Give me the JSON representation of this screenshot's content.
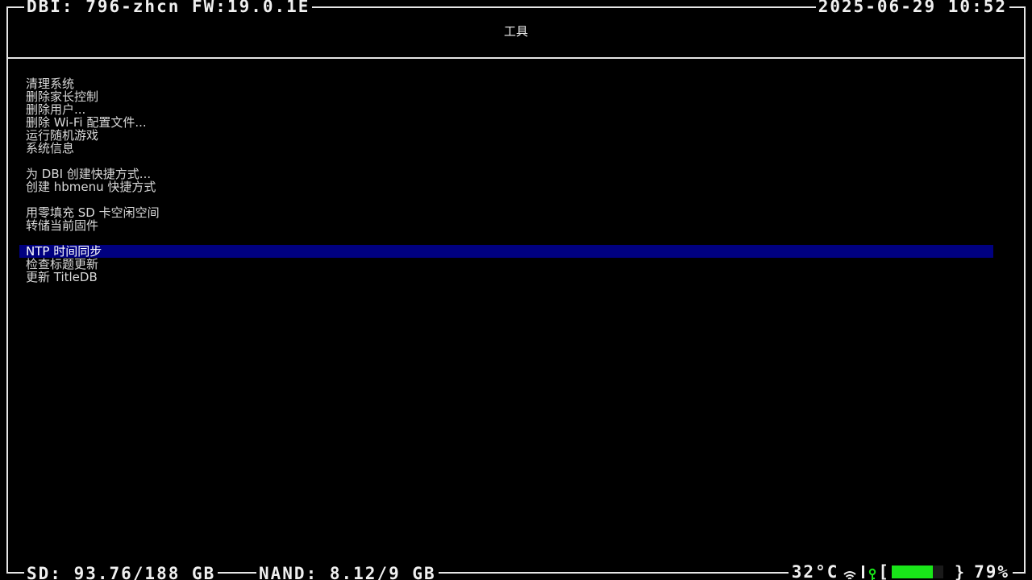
{
  "top_bar": {
    "left": "DBI: 796-zhcn FW:19.0.1E",
    "right": "2025-06-29 10:52"
  },
  "header": {
    "title": "工具"
  },
  "menu": {
    "items": [
      "清理系统",
      "删除家长控制",
      "删除用户...",
      "删除 Wi-Fi 配置文件...",
      "运行随机游戏",
      "系统信息",
      "为 DBI 创建快捷方式...",
      "创建 hbmenu 快捷方式",
      "用零填充 SD 卡空闲空间",
      "转储当前固件",
      "NTP 时间同步",
      "检查标题更新",
      "更新 TitleDB"
    ],
    "selected_index": 10
  },
  "bottom_bar": {
    "sd": "SD: 93.76/188 GB",
    "nand": "NAND: 8.12/9 GB",
    "temperature": "32°C",
    "battery_bracket_open": "[",
    "battery_bracket_close": "}",
    "battery_percent": "79%",
    "battery_level": 0.79
  },
  "colors": {
    "background": "#000000",
    "foreground": "#e6e6e6",
    "selection": "#000080",
    "battery": "#19e619"
  },
  "icons": {
    "wifi": "wifi-icon",
    "charging": "plug-icon"
  }
}
